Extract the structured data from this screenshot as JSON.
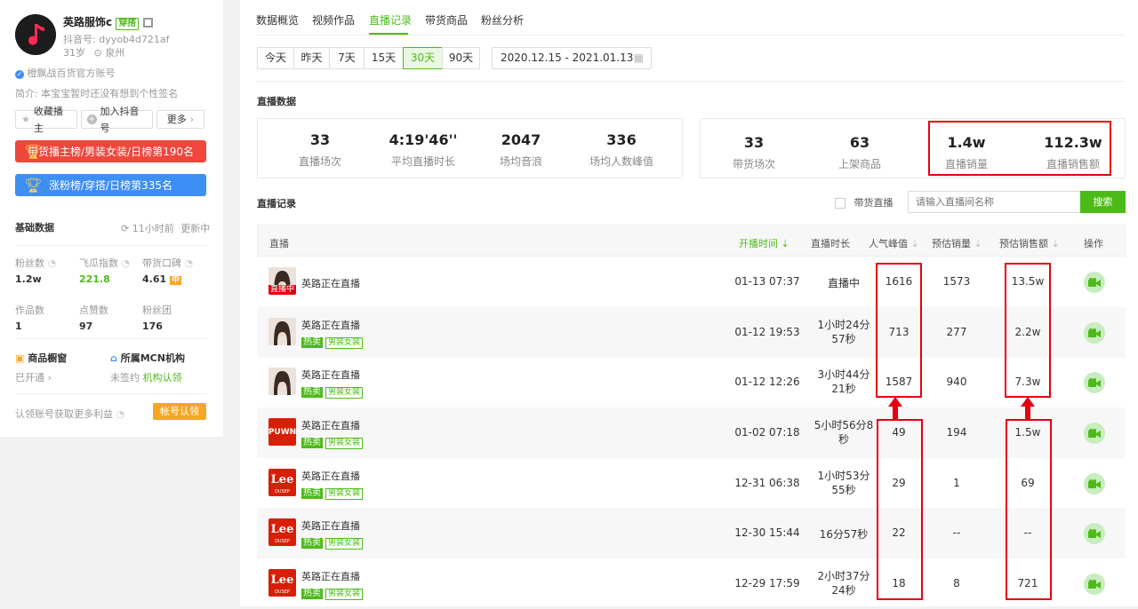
{
  "profile": {
    "name": "英路服饰c",
    "name_tag": "穿搭",
    "douyin_id": "抖音号: dyyob4d721af",
    "age": "31岁",
    "location": "泉州",
    "verified": "橙飘战百货官方账号",
    "bio": "简介: 本宝宝暂时还没有想到个性签名",
    "actions": {
      "favorite": "收藏播主",
      "add": "加入抖音号",
      "more": "更多"
    },
    "rank_sales": "带货播主榜/男装女装/日榜第190名",
    "rank_fans": "涨粉榜/穿搭/日榜第335名"
  },
  "basic": {
    "title": "基础数据",
    "update_time": "11小时前",
    "update_label": "更新中",
    "stats": [
      {
        "label": "粉丝数",
        "value": "1.2w"
      },
      {
        "label": "飞瓜指数",
        "value": "221.8"
      },
      {
        "label": "带货口碑",
        "value": "4.61",
        "badge": "中"
      },
      {
        "label": "作品数",
        "value": "1"
      },
      {
        "label": "点赞数",
        "value": "97"
      },
      {
        "label": "粉丝团",
        "value": "176"
      }
    ],
    "shop_title": "商品橱窗",
    "shop_status": "已开通",
    "mcn_title": "所属MCN机构",
    "mcn_status": "未签约",
    "mcn_link": "机构认领",
    "claim_text": "认领账号获取更多利益",
    "claim_button": "帐号认领"
  },
  "tabs": [
    "数据概览",
    "视频作品",
    "直播记录",
    "带货商品",
    "粉丝分析"
  ],
  "active_tab": 2,
  "ranges": [
    "今天",
    "昨天",
    "7天",
    "15天",
    "30天",
    "90天"
  ],
  "active_range": 4,
  "date_range": "2020.12.15 - 2021.01.13",
  "live_data": {
    "title": "直播数据",
    "left": [
      {
        "value": "33",
        "label": "直播场次"
      },
      {
        "value": "4:19'46''",
        "label": "平均直播时长"
      },
      {
        "value": "2047",
        "label": "场均音浪"
      },
      {
        "value": "336",
        "label": "场均人数峰值"
      }
    ],
    "right": [
      {
        "value": "33",
        "label": "带货场次"
      },
      {
        "value": "63",
        "label": "上架商品"
      },
      {
        "value": "1.4w",
        "label": "直播销量"
      },
      {
        "value": "112.3w",
        "label": "直播销售额"
      }
    ]
  },
  "records": {
    "title": "直播记录",
    "filter_label": "带货直播",
    "search_placeholder": "请输入直播间名称",
    "search_button": "搜索",
    "headers": [
      "直播",
      "开播时间",
      "直播时长",
      "人气峰值",
      "预估销量",
      "预估销售额",
      "操作"
    ],
    "rows": [
      {
        "title": "英路正在直播",
        "live_badge": "直播中",
        "hot": "",
        "cat": "",
        "time": "01-13 07:37",
        "dur1": "直播中",
        "dur2": "",
        "peak": "1616",
        "sales": "1573",
        "revenue": "13.5w",
        "thumb": "girl"
      },
      {
        "title": "英路正在直播",
        "live_badge": "",
        "hot": "热卖",
        "cat": "男装女装",
        "time": "01-12 19:53",
        "dur1": "1小时24分",
        "dur2": "57秒",
        "peak": "713",
        "sales": "277",
        "revenue": "2.2w",
        "thumb": "girl"
      },
      {
        "title": "英路正在直播",
        "live_badge": "",
        "hot": "热卖",
        "cat": "男装女装",
        "time": "01-12 12:26",
        "dur1": "3小时44分",
        "dur2": "21秒",
        "peak": "1587",
        "sales": "940",
        "revenue": "7.3w",
        "thumb": "girl"
      },
      {
        "title": "英路正在直播",
        "live_badge": "",
        "hot": "热卖",
        "cat": "男装女装",
        "time": "01-02 07:18",
        "dur1": "5小时56分8",
        "dur2": "秒",
        "peak": "49",
        "sales": "194",
        "revenue": "1.5w",
        "thumb": "puwn"
      },
      {
        "title": "英路正在直播",
        "live_badge": "",
        "hot": "热卖",
        "cat": "男装女装",
        "time": "12-31 06:38",
        "dur1": "1小时53分",
        "dur2": "55秒",
        "peak": "29",
        "sales": "1",
        "revenue": "69",
        "thumb": "lee"
      },
      {
        "title": "英路正在直播",
        "live_badge": "",
        "hot": "热卖",
        "cat": "男装女装",
        "time": "12-30 15:44",
        "dur1": "16分57秒",
        "dur2": "",
        "peak": "22",
        "sales": "--",
        "revenue": "--",
        "thumb": "lee"
      },
      {
        "title": "英路正在直播",
        "live_badge": "",
        "hot": "热卖",
        "cat": "男装女装",
        "time": "12-29 17:59",
        "dur1": "2小时37分",
        "dur2": "24秒",
        "peak": "18",
        "sales": "8",
        "revenue": "721",
        "thumb": "lee"
      }
    ]
  },
  "brand_puwn": "PUWN",
  "brand_lee": "Lee",
  "brand_lee_sub": "DUSEP",
  "colors": {
    "accent": "#4cbb17",
    "highlight": "#e60012",
    "rank_red": "#f0463c",
    "rank_blue": "#3d8ef5"
  }
}
